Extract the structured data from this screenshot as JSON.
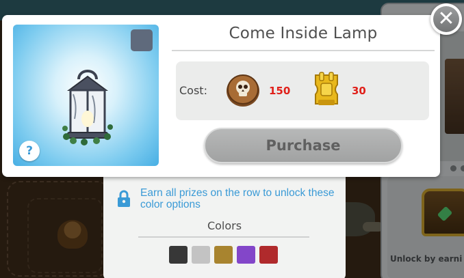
{
  "item": {
    "title": "Come Inside Lamp",
    "help_label": "?"
  },
  "cost": {
    "label": "Cost:",
    "currencies": [
      {
        "icon": "skull-coin-icon",
        "value": "150"
      },
      {
        "icon": "golden-ticket-icon",
        "value": "30"
      }
    ]
  },
  "purchase_label": "Purchase",
  "close_label": "✕",
  "color_options": {
    "unlock_message": "Earn all prizes on the row to unlock these color options",
    "heading": "Colors",
    "swatches": [
      "#373737",
      "#c3c3c3",
      "#a8842f",
      "#8346c9",
      "#b02a2c"
    ]
  },
  "side_panel": {
    "unlock_text": "Unlock by earni prize"
  },
  "colors": {
    "accent_blue": "#3a9ad6",
    "cost_red": "#e0201a"
  }
}
